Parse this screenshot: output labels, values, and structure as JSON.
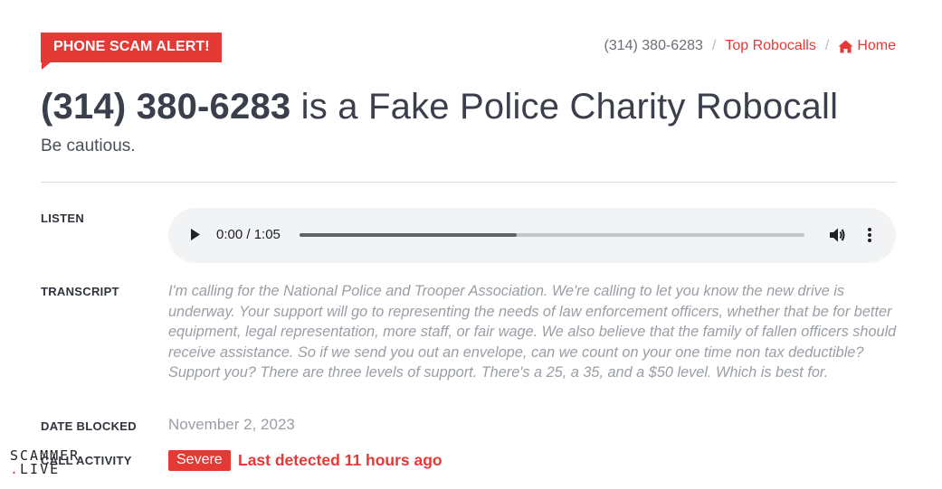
{
  "badge": {
    "label": "PHONE SCAM ALERT!"
  },
  "breadcrumb": {
    "current": "(314) 380-6283",
    "separator": "/",
    "top_robocalls": "Top Robocalls",
    "home": "Home"
  },
  "heading": {
    "number": "(314) 380-6283",
    "rest": " is a Fake Police Charity Robocall",
    "subtitle": "Be cautious."
  },
  "listen": {
    "label": "LISTEN",
    "player": {
      "time": "0:00 / 1:05",
      "progress": 0.43
    }
  },
  "transcript": {
    "label": "TRANSCRIPT",
    "text": "I'm calling for the National Police and Trooper Association. We're calling to let you know the new drive is underway. Your support will go to representing the needs of law enforcement officers, whether that be for better equipment, legal representation, more staff, or fair wage. We also believe that the family of fallen officers should receive assistance. So if we send you out an envelope, can we count on your one time non tax deductible? Support you? There are three levels of support. There's a 25, a 35, and a $50 level. Which is best for."
  },
  "date_blocked": {
    "label": "DATE BLOCKED",
    "value": "November 2, 2023"
  },
  "call_activity": {
    "label": "CALL ACTIVITY",
    "severity": "Severe",
    "last_detected": "Last detected 11 hours ago"
  },
  "watermark": {
    "line1": "SCAMMER",
    "line2": "LIVE"
  },
  "colors": {
    "accent": "#e53935",
    "text": "#3a3f4b",
    "muted": "#9a9ea5",
    "player_bg": "#f1f3f4"
  },
  "icons": {
    "home": "home-icon",
    "play": "play-icon",
    "volume": "volume-icon",
    "more": "more-vert-icon"
  }
}
